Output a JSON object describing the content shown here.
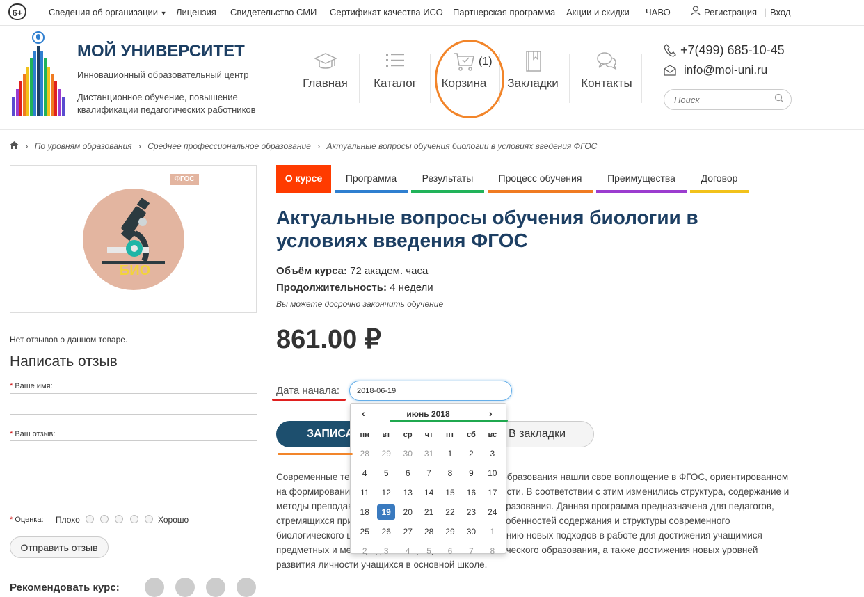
{
  "age_rating": "6+",
  "topnav": {
    "items": [
      "Сведения об организации",
      "Лицензия",
      "Свидетельство СМИ",
      "Сертификат качества ИСО",
      "Партнерская программа",
      "Акции и скидки",
      "ЧАВО"
    ],
    "register": "Регистрация",
    "login": "Вход",
    "separator": "|"
  },
  "logo": {
    "title": "МОЙ УНИВЕРСИТЕТ",
    "subtitle": "Инновационный образовательный центр",
    "description": "Дистанционное обучение, повышение квалификации педагогических работников"
  },
  "mainnav": {
    "home": "Главная",
    "catalog": "Каталог",
    "cart": "Корзина",
    "cart_count": "(1)",
    "bookmarks": "Закладки",
    "contacts": "Контакты"
  },
  "contacts": {
    "phone": "+7(499) 685-10-45",
    "email": "info@moi-uni.ru",
    "search_placeholder": "Поиск"
  },
  "breadcrumb": [
    "По уровням образования",
    "Среднее профессиональное образование",
    "Актуальные вопросы обучения биологии в условиях введения ФГОС"
  ],
  "product_image": {
    "badge": "ФГОС",
    "label": "БИО"
  },
  "reviews": {
    "no_reviews": "Нет отзывов о данном товаре.",
    "write_title": "Написать отзыв",
    "name_label": "Ваше имя:",
    "review_label": "Ваш отзыв:",
    "rating_label": "Оценка:",
    "bad": "Плохо",
    "good": "Хорошо",
    "submit": "Отправить отзыв",
    "recommend": "Рекомендовать курс:"
  },
  "tabs": [
    {
      "label": "О курсе",
      "color": "#ff3b00"
    },
    {
      "label": "Программа",
      "color": "#2f7fd0"
    },
    {
      "label": "Результаты",
      "color": "#21b35a"
    },
    {
      "label": "Процесс обучения",
      "color": "#f07b22"
    },
    {
      "label": "Преимущества",
      "color": "#9b3ccf"
    },
    {
      "label": "Договор",
      "color": "#f2c21b"
    }
  ],
  "course": {
    "title": "Актуальные вопросы обучения биологии в условиях введения ФГОС",
    "volume_label": "Объём курса:",
    "volume_value": "72 академ. часа",
    "duration_label": "Продолжительность:",
    "duration_value": "4 недели",
    "note": "Вы можете досрочно закончить обучение",
    "price": "861.00 ₽",
    "date_label": "Дата начала:",
    "date_value": "2018-06-19",
    "enroll": "ЗАПИСАТЬСЯ",
    "bookmark": "В закладки",
    "description": "Современные тенденции развития биологического образования нашли свое воплощение в ФГОС, ориентированном на формирование ключевых компетентностей личности. В соответствии с этим изменились структура, содержание и методы преподавания школьного биологического образования. Данная программа предназначена для педагогов, стремящихся прийти к пониманию и осмыслению особенностей содержания и структуры современного биологического школьного образования, использованию новых подходов в работе для достижения учащимися предметных и метапредметных результатов биологического образования, а также достижения новых уровней развития личности учащихся в основной школе."
  },
  "calendar": {
    "prev": "‹",
    "next": "›",
    "month": "июнь 2018",
    "weekdays": [
      "пн",
      "вт",
      "ср",
      "чт",
      "пт",
      "сб",
      "вс"
    ],
    "weeks": [
      [
        "28",
        "29",
        "30",
        "31",
        "1",
        "2",
        "3"
      ],
      [
        "4",
        "5",
        "6",
        "7",
        "8",
        "9",
        "10"
      ],
      [
        "11",
        "12",
        "13",
        "14",
        "15",
        "16",
        "17"
      ],
      [
        "18",
        "19",
        "20",
        "21",
        "22",
        "23",
        "24"
      ],
      [
        "25",
        "26",
        "27",
        "28",
        "29",
        "30",
        "1"
      ],
      [
        "2",
        "3",
        "4",
        "5",
        "6",
        "7",
        "8"
      ]
    ],
    "selected": "19"
  },
  "annotation_colors": {
    "circle": "#f2852a",
    "red": "#e0201f",
    "green": "#1fa84f",
    "orange": "#f2852a"
  }
}
